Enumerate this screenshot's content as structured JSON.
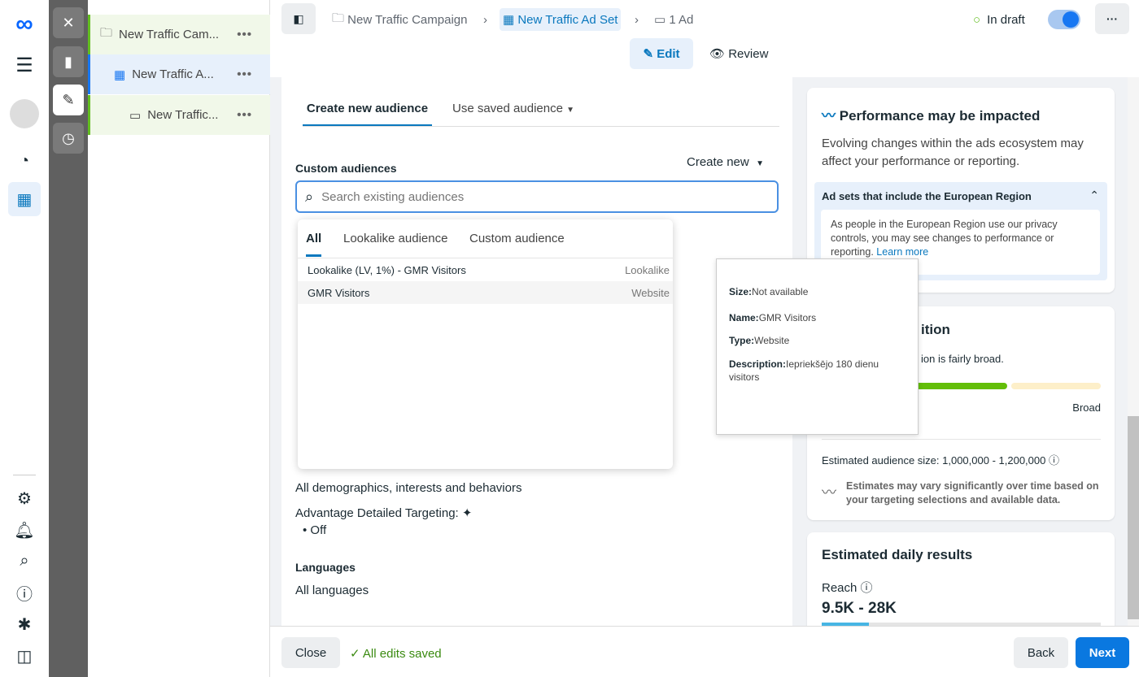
{
  "nav": {
    "icons": [
      "meta-logo-icon",
      "menu-icon",
      "avatar",
      "dashboard-icon",
      "table-icon",
      "gear-icon",
      "bell-icon",
      "search-icon",
      "help-icon",
      "bug-icon",
      "panel-icon"
    ]
  },
  "tree": {
    "items": [
      {
        "label": "New Traffic Cam...",
        "icon": "folder-icon"
      },
      {
        "label": "New Traffic A...",
        "icon": "grid-icon"
      },
      {
        "label": "New Traffic...",
        "icon": "ad-icon"
      }
    ]
  },
  "header": {
    "breadcrumb": [
      "New Traffic Campaign",
      "New Traffic Ad Set",
      "1 Ad"
    ],
    "status": "In draft",
    "edit": "Edit",
    "review": "Review",
    "accent": "#0a78be"
  },
  "main": {
    "tabs": [
      "Create new audience",
      "Use saved audience"
    ],
    "custom_audiences": "Custom audiences",
    "create_new": "Create new",
    "search_placeholder": "Search existing audiences",
    "detailed_value": "All demographics, interests and behaviors",
    "advantage": "Advantage Detailed Targeting:",
    "advantage_value": "Off",
    "languages": "Languages",
    "languages_value": "All languages"
  },
  "dropdown": {
    "tabs": [
      "All",
      "Lookalike audience",
      "Custom audience"
    ],
    "rows": [
      {
        "name": "Lookalike (LV, 1%) - GMR Visitors",
        "type": "Lookalike"
      },
      {
        "name": "GMR Visitors",
        "type": "Website"
      }
    ]
  },
  "tooltip": {
    "size_label": "Size:",
    "size": "Not available",
    "name_label": "Name:",
    "name": "GMR Visitors",
    "type_label": "Type:",
    "type": "Website",
    "desc_label": "Description:",
    "desc": "Iepriekšējo 180 dienu visitors"
  },
  "right": {
    "perf_title": "Performance may be impacted",
    "perf_text": "Evolving changes within the ads ecosystem may affect your performance or reporting.",
    "eu_title": "Ad sets that include the European Region",
    "eu_text": "As people in the European Region use our privacy controls, you may see changes to performance or reporting.",
    "learn_more": "Learn more",
    "def_title": "ition",
    "def_text": "ion is fairly broad.",
    "broad": "Broad",
    "audience_size": "Estimated audience size: 1,000,000 - 1,200,000",
    "estimates_note": "Estimates may vary significantly over time based on your targeting selections and available data.",
    "daily_title": "Estimated daily results",
    "reach": "Reach",
    "reach_value": "9.5K - 28K"
  },
  "footer": {
    "close": "Close",
    "saved": "All edits saved",
    "back": "Back",
    "next": "Next"
  }
}
